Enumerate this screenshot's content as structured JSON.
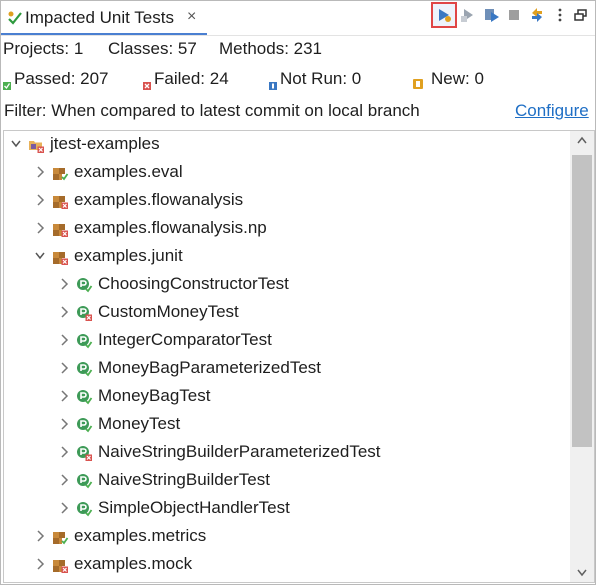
{
  "tab": {
    "title": "Impacted Unit Tests",
    "close": "×",
    "icon": "impacted-tests-icon"
  },
  "toolbar": [
    "run-icon",
    "run-selected-icon",
    "run-impacted-icon",
    "stop-icon",
    "sync-icon",
    "more-icon",
    "restore-icon"
  ],
  "summary": {
    "projects": "Projects: 1",
    "classes": "Classes: 57",
    "methods": "Methods: 231",
    "passed": "Passed: 207",
    "failed": "Failed: 24",
    "not_run": "Not Run: 0",
    "new": "New: 0"
  },
  "colors": {
    "passed": "#4caf50",
    "failed": "#d9534f",
    "not_run": "#3a78c3",
    "new": "#e0a020",
    "link": "#1f6fc5"
  },
  "filter": {
    "text": "Filter: When compared to latest commit on local branch",
    "link": "Configure"
  },
  "tree": [
    {
      "label": "jtest-examples",
      "kind": "project",
      "expanded": true,
      "status": "failed"
    },
    {
      "label": "examples.eval",
      "kind": "package",
      "expanded": false,
      "status": "passed"
    },
    {
      "label": "examples.flowanalysis",
      "kind": "package",
      "expanded": false,
      "status": "failed"
    },
    {
      "label": "examples.flowanalysis.np",
      "kind": "package",
      "expanded": false,
      "status": "failed"
    },
    {
      "label": "examples.junit",
      "kind": "package",
      "expanded": true,
      "status": "failed"
    },
    {
      "label": "ChoosingConstructorTest",
      "kind": "class",
      "expanded": false,
      "status": "passed"
    },
    {
      "label": "CustomMoneyTest",
      "kind": "class",
      "expanded": false,
      "status": "failed"
    },
    {
      "label": "IntegerComparatorTest",
      "kind": "class",
      "expanded": false,
      "status": "passed"
    },
    {
      "label": "MoneyBagParameterizedTest",
      "kind": "class",
      "expanded": false,
      "status": "passed"
    },
    {
      "label": "MoneyBagTest",
      "kind": "class",
      "expanded": false,
      "status": "passed"
    },
    {
      "label": "MoneyTest",
      "kind": "class",
      "expanded": false,
      "status": "passed"
    },
    {
      "label": "NaiveStringBuilderParameterizedTest",
      "kind": "class",
      "expanded": false,
      "status": "failed"
    },
    {
      "label": "NaiveStringBuilderTest",
      "kind": "class",
      "expanded": false,
      "status": "passed"
    },
    {
      "label": "SimpleObjectHandlerTest",
      "kind": "class",
      "expanded": false,
      "status": "passed"
    },
    {
      "label": "examples.metrics",
      "kind": "package",
      "expanded": false,
      "status": "passed"
    },
    {
      "label": "examples.mock",
      "kind": "package",
      "expanded": false,
      "status": "failed"
    }
  ]
}
